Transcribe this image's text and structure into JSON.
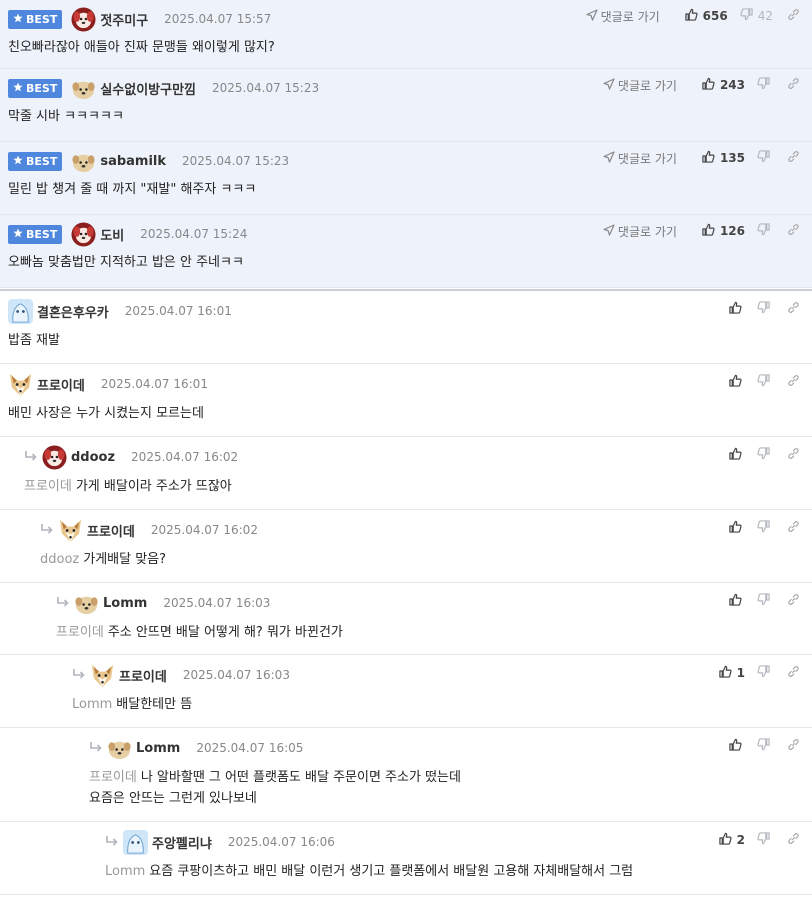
{
  "colors": {
    "best_bg": "#eef3fb",
    "badge": "#4f86de",
    "mention": "#999999"
  },
  "labels": {
    "best": "BEST",
    "goto": "댓글로 가기"
  },
  "comments": [
    {
      "best": true,
      "nick": "젓주미구",
      "time": "2025.04.07 15:57",
      "mention": "",
      "lines": [
        "친오빠라잖아 애들아 진짜 문맹들 왜이렇게 많지?"
      ],
      "up": "656",
      "down": "42",
      "avatar": "dog-red"
    },
    {
      "best": true,
      "nick": "실수없이방구만낌",
      "time": "2025.04.07 15:23",
      "mention": "",
      "lines": [
        "막줄 시바 ㅋㅋㅋㅋㅋ"
      ],
      "up": "243",
      "down": "",
      "avatar": "dog-beige"
    },
    {
      "best": true,
      "nick": "sabamilk",
      "time": "2025.04.07 15:23",
      "mention": "",
      "lines": [
        "밀린 밥 챙겨 줄 때 까지 \"재발\" 해주자 ㅋㅋㅋ"
      ],
      "up": "135",
      "down": "",
      "avatar": "dog-beige"
    },
    {
      "best": true,
      "nick": "도비",
      "time": "2025.04.07 15:24",
      "mention": "",
      "lines": [
        "오빠놈 맞춤법만 지적하고 밥은 안 주네ㅋㅋ"
      ],
      "up": "126",
      "down": "",
      "avatar": "dog-red"
    },
    {
      "best": false,
      "nick": "결혼은후우카",
      "time": "2025.04.07 16:01",
      "mention": "",
      "lines": [
        "밥좀 재발"
      ],
      "up": "",
      "down": "",
      "avatar": "ghost"
    },
    {
      "best": false,
      "nick": "프로이데",
      "time": "2025.04.07 16:01",
      "mention": "",
      "lines": [
        "배민 사장은 누가 시켰는지 모르는데"
      ],
      "up": "",
      "down": "",
      "avatar": "fox"
    },
    {
      "best": false,
      "nick": "ddooz",
      "time": "2025.04.07 16:02",
      "mention": "프로이데",
      "lines": [
        "가게 배달이라 주소가 뜨잖아"
      ],
      "up": "",
      "down": "",
      "avatar": "dog-red"
    },
    {
      "best": false,
      "nick": "프로이데",
      "time": "2025.04.07 16:02",
      "mention": "ddooz",
      "lines": [
        "가게배달 맞음?"
      ],
      "up": "",
      "down": "",
      "avatar": "fox"
    },
    {
      "best": false,
      "nick": "Lomm",
      "time": "2025.04.07 16:03",
      "mention": "프로이데",
      "lines": [
        "주소 안뜨면 배달 어떻게 해? 뭐가 바뀐건가"
      ],
      "up": "",
      "down": "",
      "avatar": "dog-beige"
    },
    {
      "best": false,
      "nick": "프로이데",
      "time": "2025.04.07 16:03",
      "mention": "Lomm",
      "lines": [
        "배달한테만 뜸"
      ],
      "up": "1",
      "down": "",
      "avatar": "fox"
    },
    {
      "best": false,
      "nick": "Lomm",
      "time": "2025.04.07 16:05",
      "mention": "프로이데",
      "lines": [
        "나 알바할땐 그 어떤 플랫폼도 배달 주문이면 주소가 떴는데",
        "요즘은 안뜨는 그런게 있나보네"
      ],
      "up": "",
      "down": "",
      "avatar": "dog-beige"
    },
    {
      "best": false,
      "nick": "주앙펠리냐",
      "time": "2025.04.07 16:06",
      "mention": "Lomm",
      "lines": [
        "요즘 쿠팡이츠하고 배민 배달 이런거 생기고 플랫폼에서 배달원 고용해 자체배달해서 그럼"
      ],
      "up": "2",
      "down": "",
      "avatar": "ghost"
    }
  ]
}
